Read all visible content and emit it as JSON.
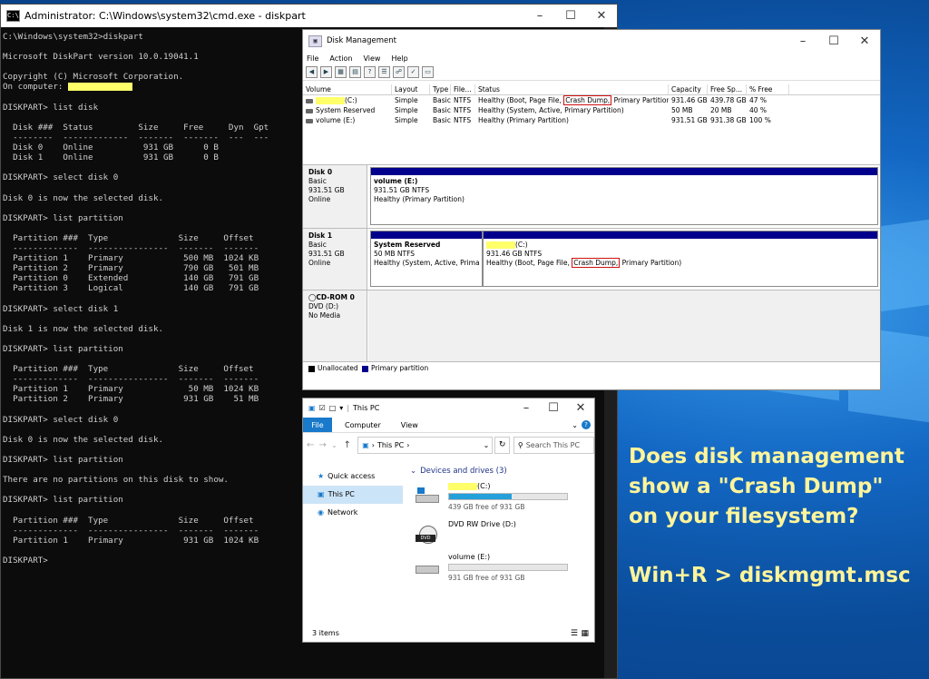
{
  "colors": {
    "highlight": "#ffff6a",
    "partition_bar": "#00008c",
    "overlay_text": "#fff49a",
    "file_tab": "#1979ca",
    "crash_box": "#d01010"
  },
  "cmd": {
    "title": "Administrator: C:\\Windows\\system32\\cmd.exe - diskpart",
    "lines": [
      "C:\\Windows\\system32>diskpart",
      "",
      "Microsoft DiskPart version 10.0.19041.1",
      "",
      "Copyright (C) Microsoft Corporation.",
      "On computer: ",
      "",
      "DISKPART> list disk",
      "",
      "  Disk ###  Status         Size     Free     Dyn  Gpt",
      "  --------  -------------  -------  -------  ---  ---",
      "  Disk 0    Online          931 GB      0 B",
      "  Disk 1    Online          931 GB      0 B",
      "",
      "DISKPART> select disk 0",
      "",
      "Disk 0 is now the selected disk.",
      "",
      "DISKPART> list partition",
      "",
      "  Partition ###  Type              Size     Offset",
      "  -------------  ----------------  -------  -------",
      "  Partition 1    Primary            500 MB  1024 KB",
      "  Partition 2    Primary            790 GB   501 MB",
      "  Partition 0    Extended           140 GB   791 GB",
      "  Partition 3    Logical            140 GB   791 GB",
      "",
      "DISKPART> select disk 1",
      "",
      "Disk 1 is now the selected disk.",
      "",
      "DISKPART> list partition",
      "",
      "  Partition ###  Type              Size     Offset",
      "  -------------  ----------------  -------  -------",
      "  Partition 1    Primary             50 MB  1024 KB",
      "  Partition 2    Primary            931 GB    51 MB",
      "",
      "DISKPART> select disk 0",
      "",
      "Disk 0 is now the selected disk.",
      "",
      "DISKPART> list partition",
      "",
      "There are no partitions on this disk to show.",
      "",
      "DISKPART> list partition",
      "",
      "  Partition ###  Type              Size     Offset",
      "  -------------  ----------------  -------  -------",
      "  Partition 1    Primary            931 GB  1024 KB",
      "",
      "DISKPART> "
    ]
  },
  "diskmgmt": {
    "title": "Disk Management",
    "menu": [
      "File",
      "Action",
      "View",
      "Help"
    ],
    "columns": [
      "Volume",
      "Layout",
      "Type",
      "File...",
      "Status",
      "Capacity",
      "Free Sp...",
      "% Free"
    ],
    "volumes": [
      {
        "name": "(C:)",
        "layout": "Simple",
        "type": "Basic",
        "fs": "NTFS",
        "status_pre": "Healthy (Boot, Page File, ",
        "status_box": "Crash Dump,",
        "status_post": " Primary Partition)",
        "capacity": "931.46 GB",
        "free": "439.78 GB",
        "pct": "47 %"
      },
      {
        "name": "System Reserved",
        "layout": "Simple",
        "type": "Basic",
        "fs": "NTFS",
        "status_pre": "Healthy (System, Active, Primary Partition)",
        "status_box": "",
        "status_post": "",
        "capacity": "50 MB",
        "free": "20 MB",
        "pct": "40 %"
      },
      {
        "name": "volume (E:)",
        "layout": "Simple",
        "type": "Basic",
        "fs": "NTFS",
        "status_pre": "Healthy (Primary Partition)",
        "status_box": "",
        "status_post": "",
        "capacity": "931.51 GB",
        "free": "931.38 GB",
        "pct": "100 %"
      }
    ],
    "disks": [
      {
        "name": "Disk 0",
        "kind": "Basic",
        "size": "931.51 GB",
        "state": "Online"
      },
      {
        "name": "Disk 1",
        "kind": "Basic",
        "size": "931.51 GB",
        "state": "Online"
      },
      {
        "name": "CD-ROM 0",
        "kind": "DVD (D:)",
        "size": "",
        "state": "No Media"
      }
    ],
    "partitions": {
      "d0p1": {
        "name": "volume (E:)",
        "size": "931.51 GB NTFS",
        "status": "Healthy (Primary Partition)"
      },
      "d1p1": {
        "name": "System Reserved",
        "size": "50 MB NTFS",
        "status": "Healthy (System, Active, Prima"
      },
      "d1p2": {
        "name": "(C:)",
        "size": "931.46 GB NTFS",
        "status_pre": "Healthy (Boot, Page File, ",
        "status_box": "Crash Dump,",
        "status_post": " Primary Partition)"
      }
    },
    "legend": [
      "Unallocated",
      "Primary partition"
    ]
  },
  "explorer": {
    "title": "This PC",
    "ribbon": {
      "file": "File",
      "computer": "Computer",
      "view": "View"
    },
    "address": "This PC",
    "search_placeholder": "Search This PC",
    "nav": [
      "Quick access",
      "This PC",
      "Network"
    ],
    "group_header": "Devices and drives (3)",
    "drives": [
      {
        "name": "(C:)",
        "free": "439 GB free of 931 GB",
        "used_fraction": 0.53
      },
      {
        "name": "DVD RW Drive (D:)",
        "free": "",
        "used_fraction": null
      },
      {
        "name": "volume (E:)",
        "free": "931 GB free of 931 GB",
        "used_fraction": 0.0
      }
    ],
    "status": "3 items"
  },
  "overlay": {
    "question": [
      "Does disk management",
      "show a \"Crash Dump\"",
      "on your filesystem?"
    ],
    "hint": "Win+R > diskmgmt.msc"
  }
}
